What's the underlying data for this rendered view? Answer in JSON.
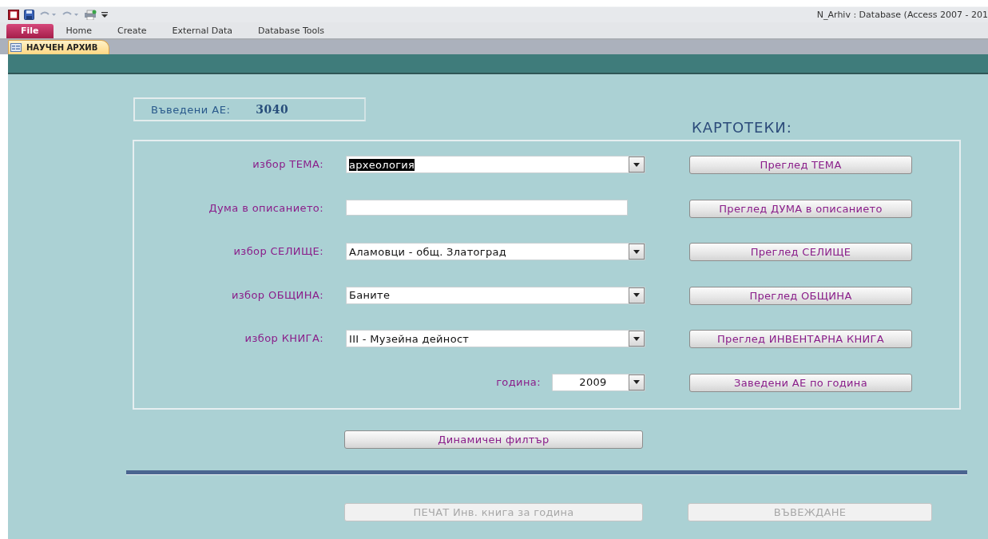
{
  "window": {
    "title": "N_Arhiv : Database (Access 2007 - 201"
  },
  "ribbon_tabs": [
    {
      "label": "File",
      "selected": true
    },
    {
      "label": "Home",
      "selected": false
    },
    {
      "label": "Create",
      "selected": false
    },
    {
      "label": "External Data",
      "selected": false
    },
    {
      "label": "Database Tools",
      "selected": false
    }
  ],
  "document_tab": {
    "label": "НАУЧЕН АРХИВ",
    "selected": true
  },
  "counter": {
    "label": "Въведени АЕ:",
    "value": "3040"
  },
  "heading": "КАРТОТЕКИ:",
  "filters": [
    {
      "kind": "combo",
      "label": "избор ТЕМА:",
      "value": "археология",
      "highlighted": true,
      "button": "Преглед ТЕМА"
    },
    {
      "kind": "text",
      "label": "Дума в описанието:",
      "highlighted": false,
      "button": "Преглед ДУМА в описанието"
    },
    {
      "kind": "combo",
      "label": "избор СЕЛИЩЕ:",
      "value": "Аламовци - общ. Златоград",
      "highlighted": false,
      "button": "Преглед СЕЛИЩЕ"
    },
    {
      "kind": "combo",
      "label": "избор ОБЩИНА:",
      "value": "Баните",
      "highlighted": false,
      "button": "Преглед ОБЩИНА"
    },
    {
      "kind": "combo",
      "label": "избор КНИГА:",
      "value": "III - Музейна дейност",
      "highlighted": false,
      "button": "Преглед ИНВЕНТАРНА КНИГА"
    },
    {
      "kind": "year",
      "label": "година:",
      "value": "2009",
      "highlighted": false,
      "button": "Заведени АЕ по година"
    }
  ],
  "filter_button": {
    "label": "Динамичен филтър",
    "disabled": false
  },
  "bottom_buttons": [
    {
      "label": "ПЕЧАТ Инв. книга за година",
      "disabled": true
    },
    {
      "label": "ВЪВЕЖДАНЕ",
      "disabled": true
    }
  ]
}
